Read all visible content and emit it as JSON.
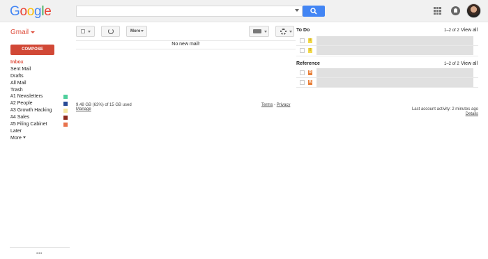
{
  "header": {
    "logo_text": "Google",
    "logo_colors": [
      "#4285f4",
      "#ea4335",
      "#fbbc05",
      "#4285f4",
      "#34a853",
      "#ea4335"
    ],
    "search": {
      "placeholder": "",
      "value": ""
    }
  },
  "sidebar": {
    "app_label": "Gmail",
    "compose_label": "COMPOSE",
    "items": [
      {
        "label": "Inbox",
        "active": true
      },
      {
        "label": "Sent Mail"
      },
      {
        "label": "Drafts"
      },
      {
        "label": "All Mail"
      },
      {
        "label": "Trash"
      },
      {
        "label": "#1 Newsletters",
        "color": "#4fcf9c"
      },
      {
        "label": "#2 People",
        "color": "#284a96"
      },
      {
        "label": "#3 Growth Hacking",
        "color": "#f5e7a1"
      },
      {
        "label": "#4 Sales",
        "color": "#8e2a1c"
      },
      {
        "label": "#5 Filing Cabinet",
        "color": "#e8724c"
      },
      {
        "label": "Later"
      },
      {
        "label": "More"
      }
    ],
    "footer_dots": "•••"
  },
  "toolbar": {
    "more_label": "More"
  },
  "main": {
    "empty_message": "No new mail!",
    "storage_text": "9.48 GB (63%) of 15 GB used",
    "manage_label": "Manage",
    "terms_label": "Terms",
    "separator": " - ",
    "privacy_label": "Privacy",
    "last_activity": "Last account activity: 2 minutes ago",
    "details_label": "Details"
  },
  "panels": [
    {
      "title": "To Do",
      "count": "1–2 of 2",
      "view_all": "View all",
      "rows": [
        {
          "marker": "!",
          "marker_color": "#f2d94d"
        },
        {
          "marker": "!",
          "marker_color": "#f2d94d"
        }
      ]
    },
    {
      "title": "Reference",
      "count": "1–2 of 2",
      "view_all": "View all",
      "rows": [
        {
          "marker": "R",
          "marker_color": "#e8803a"
        },
        {
          "marker": "R",
          "marker_color": "#e8803a"
        }
      ]
    }
  ]
}
